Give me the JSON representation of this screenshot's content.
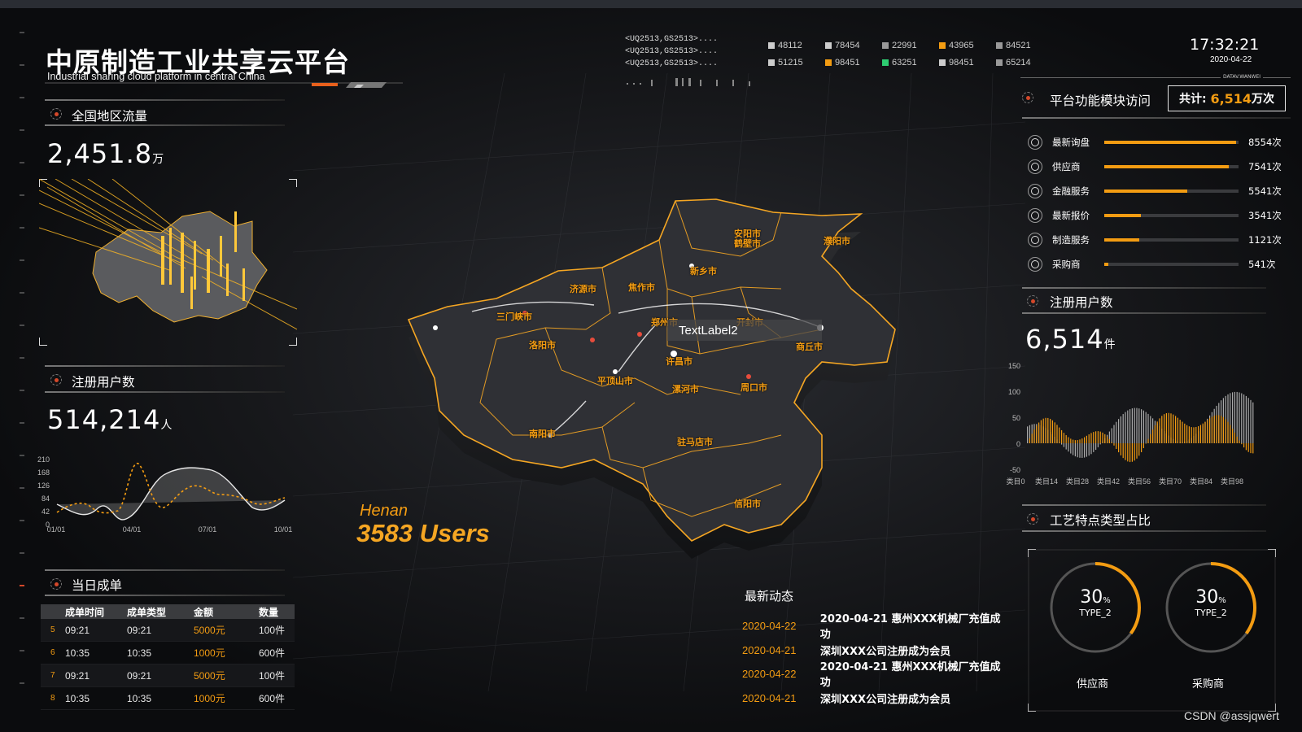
{
  "header": {
    "title_cn": "中原制造工业共享云平台",
    "title_en": "Industrial sharing cloud platform in central China",
    "ticker": [
      "<UQ2513,GS2513>....",
      "<UQ2513,GS2513>....",
      "<UQ2513,GS2513>...."
    ],
    "codes": [
      {
        "v": "48112",
        "color": "#cccccc"
      },
      {
        "v": "78454",
        "color": "#cccccc"
      },
      {
        "v": "22991",
        "color": "#999999"
      },
      {
        "v": "43965",
        "color": "#f39c12"
      },
      {
        "v": "84521",
        "color": "#999999"
      },
      {
        "v": "51215",
        "color": "#cccccc"
      },
      {
        "v": "98451",
        "color": "#f39c12"
      },
      {
        "v": "63251",
        "color": "#2ecc71"
      },
      {
        "v": "98451",
        "color": "#cccccc"
      },
      {
        "v": "65214",
        "color": "#999999"
      }
    ],
    "time": "17:32:21",
    "date": "2020-04-22",
    "datav": "DATAV.WANWEI"
  },
  "left": {
    "traffic": {
      "title": "全国地区流量",
      "value": "2,451.8",
      "unit": "万"
    },
    "users": {
      "title": "注册用户数",
      "value": "514,214",
      "unit": "人"
    },
    "line_chart": {
      "yticks": [
        "210",
        "168",
        "126",
        "84",
        "42",
        "0"
      ],
      "xticks": [
        "01/01",
        "04/01",
        "07/01",
        "10/01"
      ]
    },
    "orders": {
      "title": "当日成单",
      "headers": [
        "成单时间",
        "成单类型",
        "金额",
        "数量"
      ],
      "rows": [
        {
          "n": "5",
          "time": "09:21",
          "type": "09:21",
          "amount": "5000元",
          "qty": "100件"
        },
        {
          "n": "6",
          "time": "10:35",
          "type": "10:35",
          "amount": "1000元",
          "qty": "600件"
        },
        {
          "n": "7",
          "time": "09:21",
          "type": "09:21",
          "amount": "5000元",
          "qty": "100件"
        },
        {
          "n": "8",
          "time": "10:35",
          "type": "10:35",
          "amount": "1000元",
          "qty": "600件"
        }
      ]
    }
  },
  "map": {
    "province": "Henan",
    "users": "3583 Users",
    "text_label": "TextLabel2",
    "cities": [
      "安阳市",
      "鹤壁市",
      "濮阳市",
      "新乡市",
      "济源市",
      "焦作市",
      "三门峡市",
      "郑州市",
      "开封市",
      "洛阳市",
      "商丘市",
      "许昌市",
      "平顶山市",
      "漯河市",
      "周口市",
      "南阳市",
      "驻马店市",
      "信阳市"
    ]
  },
  "right": {
    "module": {
      "title": "平台功能模块访问",
      "total_label": "共计:",
      "total_value": "6,514",
      "total_unit": "万次",
      "items": [
        {
          "label": "最新询盘",
          "value": "8554次",
          "pct": 0.98
        },
        {
          "label": "供应商",
          "value": "7541次",
          "pct": 0.93
        },
        {
          "label": "金融服务",
          "value": "5541次",
          "pct": 0.62
        },
        {
          "label": "最新报价",
          "value": "3541次",
          "pct": 0.27
        },
        {
          "label": "制造服务",
          "value": "1121次",
          "pct": 0.26
        },
        {
          "label": "采购商",
          "value": "541次",
          "pct": 0.03
        }
      ]
    },
    "users": {
      "title": "注册用户数",
      "value": "6,514",
      "unit": "件"
    },
    "bar_chart": {
      "yticks": [
        "150",
        "100",
        "50",
        "0",
        "-50"
      ],
      "xticks": [
        "类目0",
        "类目14",
        "类目28",
        "类目42",
        "类目56",
        "类目70",
        "类目84",
        "类目98"
      ]
    },
    "craft": {
      "title": "工艺特点类型占比",
      "donuts": [
        {
          "value": "30",
          "unit": "%",
          "type": "TYPE_2",
          "name": "供应商",
          "pct": 0.3
        },
        {
          "value": "30",
          "unit": "%",
          "type": "TYPE_2",
          "name": "采购商",
          "pct": 0.3
        }
      ]
    }
  },
  "news": {
    "title": "最新动态",
    "items": [
      {
        "date": "2020-04-22",
        "text": "2020-04-21 惠州XXX机械厂充值成功"
      },
      {
        "date": "2020-04-21",
        "text": "深圳XXX公司注册成为会员"
      },
      {
        "date": "2020-04-22",
        "text": "2020-04-21 惠州XXX机械厂充值成功"
      },
      {
        "date": "2020-04-21",
        "text": "深圳XXX公司注册成为会员"
      }
    ]
  },
  "watermark": "CSDN @assjqwert",
  "colors": {
    "accent": "#f39c12",
    "panel": "#3a3b3e"
  }
}
